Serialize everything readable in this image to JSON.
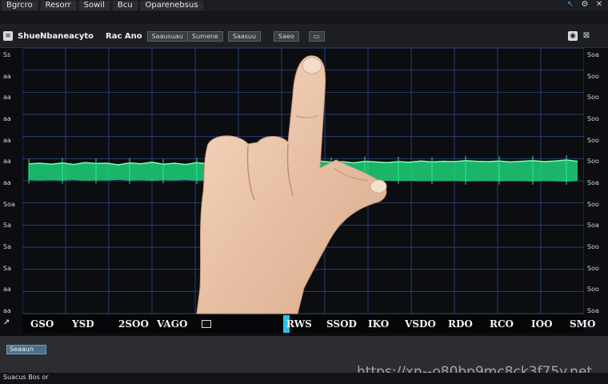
{
  "menu": {
    "items": [
      "Bgrcro",
      "Resorr",
      "Sowil",
      "Bcu",
      "Oparenebsus"
    ]
  },
  "toolbar": {
    "app_label": "Shuel",
    "section_label": "Nbaneacyto",
    "mode_label": "Rac Ano",
    "buttons": [
      "Saausuau",
      "Sumene",
      "Saasuu",
      "Saeo"
    ]
  },
  "chart": {
    "y_left_ticks": [
      "Ss",
      "aa",
      "aa",
      "aa",
      "aa",
      "aa",
      "aa",
      "Soa",
      "Sa",
      "Sa",
      "Sa",
      "aa",
      "aa"
    ],
    "y_right_ticks": [
      "Soa",
      "Soo",
      "Soo",
      "Soo",
      "Soo",
      "Soo",
      "Soa",
      "Soo",
      "Soa",
      "Soo",
      "Soo",
      "Soo",
      "Soa"
    ],
    "x_ticks": [
      "GSO",
      "YSD",
      "2SOO",
      "VAGO",
      "RWS",
      "SSOD",
      "IKO",
      "VSDO",
      "RDO",
      "RCO",
      "IOO",
      "SMO"
    ],
    "series_color": "#1fd37a",
    "grid_color": "#2a3f78"
  },
  "chart_data": {
    "type": "area",
    "series": [
      {
        "values": [
          0.38,
          0.4,
          0.37,
          0.41,
          0.36,
          0.42,
          0.39,
          0.4,
          0.35,
          0.41,
          0.38,
          0.43,
          0.37,
          0.4,
          0.36,
          0.42,
          0.38,
          0.39,
          0.41,
          0.37,
          0.4,
          0.38,
          0.42,
          0.39,
          0.44,
          0.41,
          0.47,
          0.43,
          0.45,
          0.41,
          0.46,
          0.44,
          0.42,
          0.45,
          0.43,
          0.47,
          0.44,
          0.46,
          0.45,
          0.48,
          0.46,
          0.45,
          0.47,
          0.44,
          0.46,
          0.48,
          0.45,
          0.47,
          0.5,
          0.46
        ]
      }
    ]
  },
  "status": {
    "chip_label": "Seaaun",
    "footer_text": "Suacus Bos or",
    "watermark": "https://xn--o80bp9mc8ck3f75y.net"
  },
  "window_controls": [
    "settings-icon",
    "bell-icon",
    "close-icon"
  ]
}
